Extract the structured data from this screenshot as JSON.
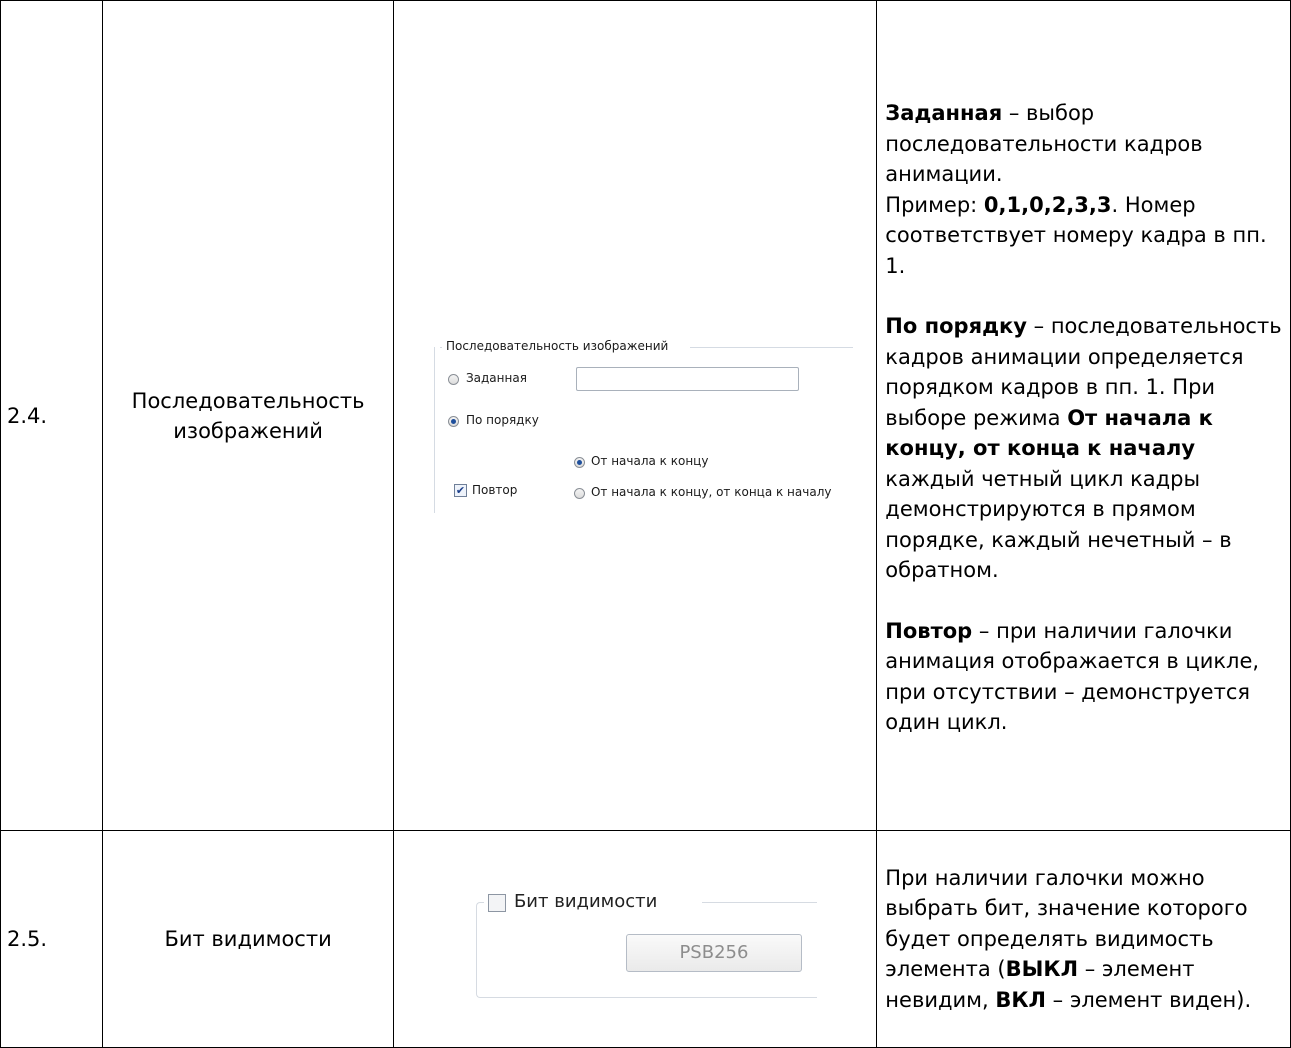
{
  "rows": [
    {
      "num": "2.4.",
      "name": "Последовательность изображений",
      "widget": {
        "group_title": "Последовательность изображений",
        "option_fixed": "Заданная",
        "option_fixed_value": "",
        "option_order": "По порядку",
        "repeat_label": "Повтор",
        "repeat_checked": true,
        "sub_start_end": "От начала к концу",
        "sub_start_end_start": "От начала к концу, от конца к началу",
        "selected_mode": "По порядку",
        "selected_sub": "От начала к концу"
      },
      "desc": {
        "p1_bold": "Заданная",
        "p1_text": " – выбор последовательности кадров анимации.",
        "p2_prefix": "Пример: ",
        "p2_bold": "0,1,0,2,3,3",
        "p2_text": ". Номер соответствует номеру кадра в пп. 1.",
        "p3_bold": "По порядку",
        "p3_text": " – последовательность кадров анимации определяется порядком кадров в пп. 1. При выборе режима ",
        "p3_bold2": "От начала к концу, от конца к началу",
        "p3_text2": " каждый четный цикл кадры демонстрируются в прямом порядке, каждый нечетный – в обратном.",
        "p4_bold": "Повтор",
        "p4_text": " – при наличии галочки анимация отображается в цикле, при отсутствии – демонструется один цикл."
      }
    },
    {
      "num": "2.5.",
      "name": "Бит видимости",
      "widget": {
        "check_label": "Бит видимости",
        "checked": false,
        "field_value": "PSB256"
      },
      "desc": {
        "p1_text": "При наличии галочки можно выбрать бит, значение которого будет определять видимость элемента (",
        "p1_bold": "ВЫКЛ",
        "p1_text2": " – элемент невидим, ",
        "p1_bold2": "ВКЛ",
        "p1_text3": " – элемент виден)."
      }
    }
  ]
}
